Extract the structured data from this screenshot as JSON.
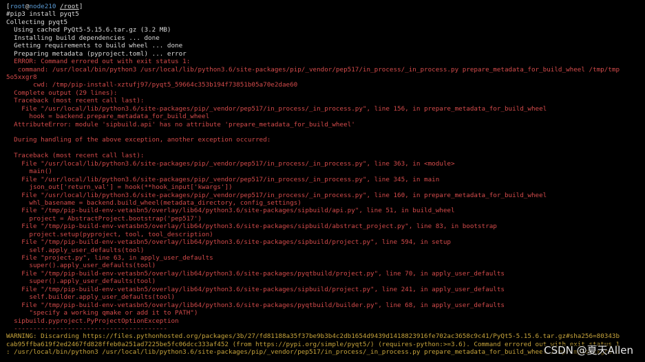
{
  "prompt": {
    "open_bracket": "[",
    "user": "root",
    "at": "@",
    "host": "node210",
    "path": "/root",
    "close_bracket": "]"
  },
  "lines": [
    {
      "text": "#pip3 install pyqt5",
      "color": "w"
    },
    {
      "text": "Collecting pyqt5",
      "color": "w"
    },
    {
      "text": "  Using cached PyQt5-5.15.6.tar.gz (3.2 MB)",
      "color": "w"
    },
    {
      "text": "  Installing build dependencies ... done",
      "color": "w"
    },
    {
      "text": "  Getting requirements to build wheel ... done",
      "color": "w"
    },
    {
      "text": "  Preparing metadata (pyproject.toml) ... error",
      "color": "w"
    },
    {
      "text": "  ERROR: Command errored out with exit status 1:",
      "color": "r"
    },
    {
      "text": "   command: /usr/local/bin/python3 /usr/local/lib/python3.6/site-packages/pip/_vendor/pep517/in_process/_in_process.py prepare_metadata_for_build_wheel /tmp/tmp",
      "color": "r"
    },
    {
      "text": "5o5xxgr8",
      "color": "r"
    },
    {
      "text": "       cwd: /tmp/pip-install-xztufj97/pyqt5_59664c353b194f73851b05a70e2dae60",
      "color": "r"
    },
    {
      "text": "  Complete output (29 lines):",
      "color": "r"
    },
    {
      "text": "  Traceback (most recent call last):",
      "color": "r"
    },
    {
      "text": "    File \"/usr/local/lib/python3.6/site-packages/pip/_vendor/pep517/in_process/_in_process.py\", line 156, in prepare_metadata_for_build_wheel",
      "color": "r"
    },
    {
      "text": "      hook = backend.prepare_metadata_for_build_wheel",
      "color": "r"
    },
    {
      "text": "  AttributeError: module 'sipbuild.api' has no attribute 'prepare_metadata_for_build_wheel'",
      "color": "r"
    },
    {
      "text": "",
      "color": "r"
    },
    {
      "text": "  During handling of the above exception, another exception occurred:",
      "color": "r"
    },
    {
      "text": "",
      "color": "r"
    },
    {
      "text": "  Traceback (most recent call last):",
      "color": "r"
    },
    {
      "text": "    File \"/usr/local/lib/python3.6/site-packages/pip/_vendor/pep517/in_process/_in_process.py\", line 363, in <module>",
      "color": "r"
    },
    {
      "text": "      main()",
      "color": "r"
    },
    {
      "text": "    File \"/usr/local/lib/python3.6/site-packages/pip/_vendor/pep517/in_process/_in_process.py\", line 345, in main",
      "color": "r"
    },
    {
      "text": "      json_out['return_val'] = hook(**hook_input['kwargs'])",
      "color": "r"
    },
    {
      "text": "    File \"/usr/local/lib/python3.6/site-packages/pip/_vendor/pep517/in_process/_in_process.py\", line 160, in prepare_metadata_for_build_wheel",
      "color": "r"
    },
    {
      "text": "      whl_basename = backend.build_wheel(metadata_directory, config_settings)",
      "color": "r"
    },
    {
      "text": "    File \"/tmp/pip-build-env-vetasbn5/overlay/lib64/python3.6/site-packages/sipbuild/api.py\", line 51, in build_wheel",
      "color": "r"
    },
    {
      "text": "      project = AbstractProject.bootstrap('pep517')",
      "color": "r"
    },
    {
      "text": "    File \"/tmp/pip-build-env-vetasbn5/overlay/lib64/python3.6/site-packages/sipbuild/abstract_project.py\", line 83, in bootstrap",
      "color": "r"
    },
    {
      "text": "      project.setup(pyproject, tool, tool_description)",
      "color": "r"
    },
    {
      "text": "    File \"/tmp/pip-build-env-vetasbn5/overlay/lib64/python3.6/site-packages/sipbuild/project.py\", line 594, in setup",
      "color": "r"
    },
    {
      "text": "      self.apply_user_defaults(tool)",
      "color": "r"
    },
    {
      "text": "    File \"project.py\", line 63, in apply_user_defaults",
      "color": "r"
    },
    {
      "text": "      super().apply_user_defaults(tool)",
      "color": "r"
    },
    {
      "text": "    File \"/tmp/pip-build-env-vetasbn5/overlay/lib64/python3.6/site-packages/pyqtbuild/project.py\", line 70, in apply_user_defaults",
      "color": "r"
    },
    {
      "text": "      super().apply_user_defaults(tool)",
      "color": "r"
    },
    {
      "text": "    File \"/tmp/pip-build-env-vetasbn5/overlay/lib64/python3.6/site-packages/sipbuild/project.py\", line 241, in apply_user_defaults",
      "color": "r"
    },
    {
      "text": "      self.builder.apply_user_defaults(tool)",
      "color": "r"
    },
    {
      "text": "    File \"/tmp/pip-build-env-vetasbn5/overlay/lib64/python3.6/site-packages/pyqtbuild/builder.py\", line 68, in apply_user_defaults",
      "color": "r"
    },
    {
      "text": "      \"specify a working qmake or add it to PATH\")",
      "color": "r"
    },
    {
      "text": "  sipbuild.pyproject.PyProjectOptionException",
      "color": "r"
    },
    {
      "text": "  ----------------------------------------",
      "color": "r"
    },
    {
      "text": "WARNING: Discarding https://files.pythonhosted.org/packages/3b/27/fd81188a35f37be9b3b4c2db1654d9439d1418823916fe702ac3658c9c41/PyQt5-5.15.6.tar.gz#sha256=80343b",
      "color": "y"
    },
    {
      "text": "cab95ffba619f2ed2467fd828ffeb0a251ad7225be5fc06dcc333af452 (from https://pypi.org/simple/pyqt5/) (requires-python:>=3.6). Command errored out with exit status 1",
      "color": "y"
    },
    {
      "text": ": /usr/local/bin/python3 /usr/local/lib/python3.6/site-packages/pip/_vendor/pep517/in_process/_in_process.py prepare_metadata_for_build_wheel /tmp/tmp5o5xxgr8 c",
      "color": "y"
    }
  ],
  "watermark": "CSDN @夏天Allen",
  "colors": {
    "background": "#000000",
    "default_text": "#dcdcdc",
    "error_text": "#d44b4b",
    "warning_text": "#c8a53c",
    "prompt_host": "#5b9bd5"
  }
}
